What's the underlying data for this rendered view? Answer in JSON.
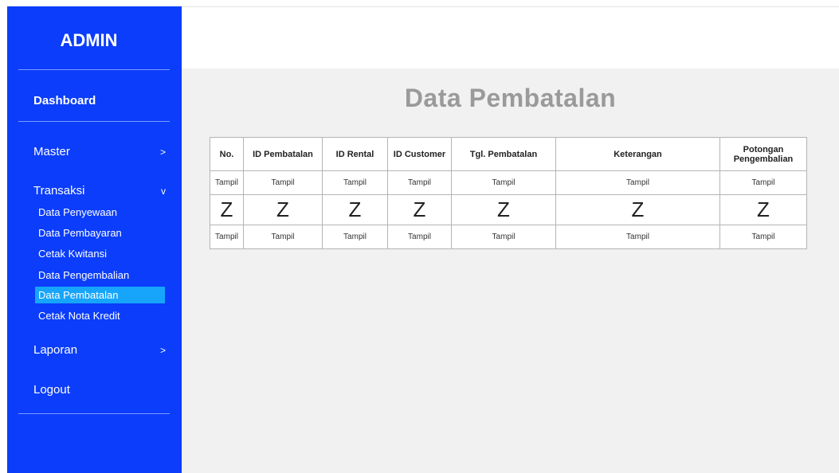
{
  "sidebar": {
    "brand": "ADMIN",
    "dashboard": "Dashboard",
    "master": {
      "label": "Master",
      "arrow": ">"
    },
    "transaksi": {
      "label": "Transaksi",
      "arrow": "v"
    },
    "submenu": [
      "Data Penyewaan",
      "Data Pembayaran",
      "Cetak Kwitansi",
      "Data Pengembalian",
      "Data Pembatalan",
      "Cetak Nota Kredit"
    ],
    "active_item": "Data Pembatalan",
    "laporan": {
      "label": "Laporan",
      "arrow": ">"
    },
    "logout": "Logout"
  },
  "main": {
    "title": "Data Pembatalan"
  },
  "table": {
    "headers": [
      "No.",
      "ID Pembatalan",
      "ID Rental",
      "ID Customer",
      "Tgl. Pembatalan",
      "Keterangan",
      "Potongan Pengembalian"
    ],
    "rows": [
      [
        "Tampil",
        "Tampil",
        "Tampil",
        "Tampil",
        "Tampil",
        "Tampil",
        "Tampil"
      ],
      [
        "Z",
        "Z",
        "Z",
        "Z",
        "Z",
        "Z",
        "Z"
      ],
      [
        "Tampil",
        "Tampil",
        "Tampil",
        "Tampil",
        "Tampil",
        "Tampil",
        "Tampil"
      ]
    ]
  },
  "colors": {
    "sidebar_bg": "#0b3dfa",
    "active_bg": "#16a5fb",
    "title_color": "#9a9a9a",
    "content_bg": "#f1f1f1"
  }
}
